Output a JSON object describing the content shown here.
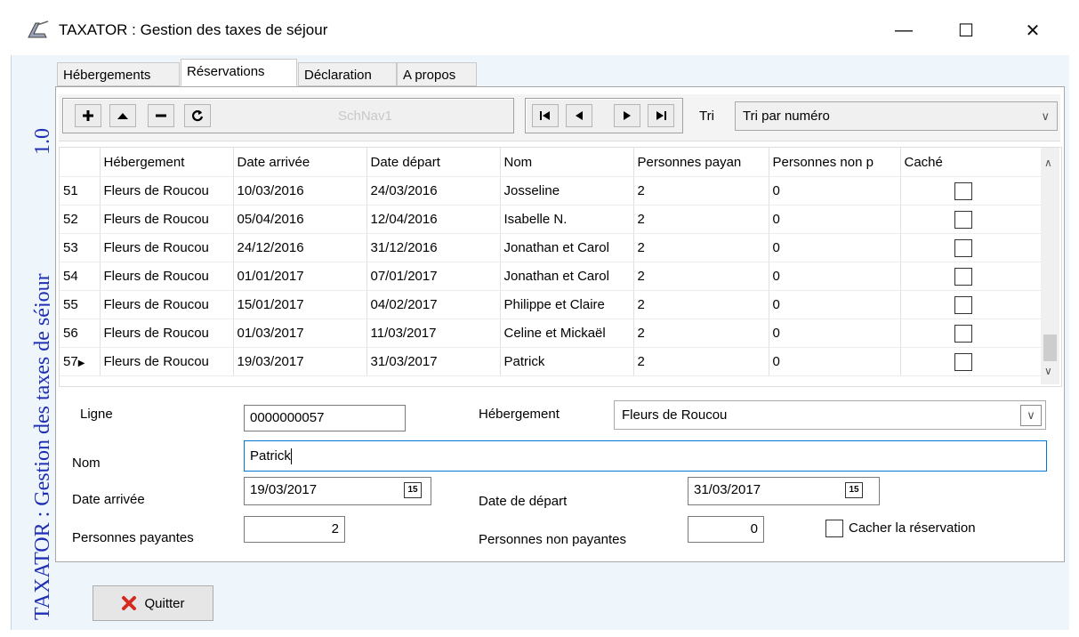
{
  "window": {
    "title": "TAXATOR : Gestion des taxes de séjour",
    "minimize_glyph": "—",
    "maximize_glyph": "☐",
    "close_glyph": "✕"
  },
  "side": {
    "title": "TAXATOR : Gestion des taxes de séjour",
    "version": "1.0"
  },
  "tabs": [
    {
      "label": "Hébergements"
    },
    {
      "label": "Réservations"
    },
    {
      "label": "Déclaration"
    },
    {
      "label": "A propos"
    }
  ],
  "active_tab": "Réservations",
  "toolbar": {
    "nav_name": "SchNav1",
    "sort_label": "Tri",
    "sort_value": "Tri par numéro",
    "icons": [
      "add-icon",
      "move-up-icon",
      "delete-icon",
      "refresh-icon",
      "first-record-icon",
      "prev-record-icon",
      "next-record-icon",
      "last-record-icon"
    ]
  },
  "grid": {
    "headers": [
      "",
      "Hébergement",
      "Date arrivée",
      "Date départ",
      "Nom",
      "Personnes payan",
      "Personnes non p",
      "Caché"
    ],
    "rows": [
      {
        "id": "51",
        "heb": "Fleurs de Roucou",
        "arr": "10/03/2016",
        "dep": "24/03/2016",
        "nom": "Josseline",
        "pay": "2",
        "nonpay": "0"
      },
      {
        "id": "52",
        "heb": "Fleurs de Roucou",
        "arr": "05/04/2016",
        "dep": "12/04/2016",
        "nom": "Isabelle N.",
        "pay": "2",
        "nonpay": "0"
      },
      {
        "id": "53",
        "heb": "Fleurs de Roucou",
        "arr": "24/12/2016",
        "dep": "31/12/2016",
        "nom": "Jonathan et Carol",
        "pay": "2",
        "nonpay": "0"
      },
      {
        "id": "54",
        "heb": "Fleurs de Roucou",
        "arr": "01/01/2017",
        "dep": "07/01/2017",
        "nom": "Jonathan et Carol",
        "pay": "2",
        "nonpay": "0"
      },
      {
        "id": "55",
        "heb": "Fleurs de Roucou",
        "arr": "15/01/2017",
        "dep": "04/02/2017",
        "nom": "Philippe et Claire",
        "pay": "2",
        "nonpay": "0"
      },
      {
        "id": "56",
        "heb": "Fleurs de Roucou",
        "arr": "01/03/2017",
        "dep": "11/03/2017",
        "nom": "Celine et Mickaël",
        "pay": "2",
        "nonpay": "0"
      },
      {
        "id": "57",
        "heb": "Fleurs de Roucou",
        "arr": "19/03/2017",
        "dep": "31/03/2017",
        "nom": "Patrick",
        "pay": "2",
        "nonpay": "0"
      }
    ],
    "current_row_id": "57"
  },
  "form": {
    "ligne_label": "Ligne",
    "ligne_value": "0000000057",
    "heb_label": "Hébergement",
    "heb_value": "Fleurs de Roucou",
    "nom_label": "Nom",
    "nom_value": "Patrick",
    "arr_label": "Date arrivée",
    "arr_value": "19/03/2017",
    "dep_label": "Date de départ",
    "dep_value": "31/03/2017",
    "pay_label": "Personnes payantes",
    "pay_value": "2",
    "nonpay_label": "Personnes non payantes",
    "nonpay_value": "0",
    "hide_label": "Cacher la réservation",
    "calendar_glyph": "15"
  },
  "footer": {
    "quit_label": "Quitter"
  },
  "colors": {
    "accent_blue": "#1f2fb3",
    "quit_red": "#d42a1f",
    "focus_border": "#0078d7"
  }
}
